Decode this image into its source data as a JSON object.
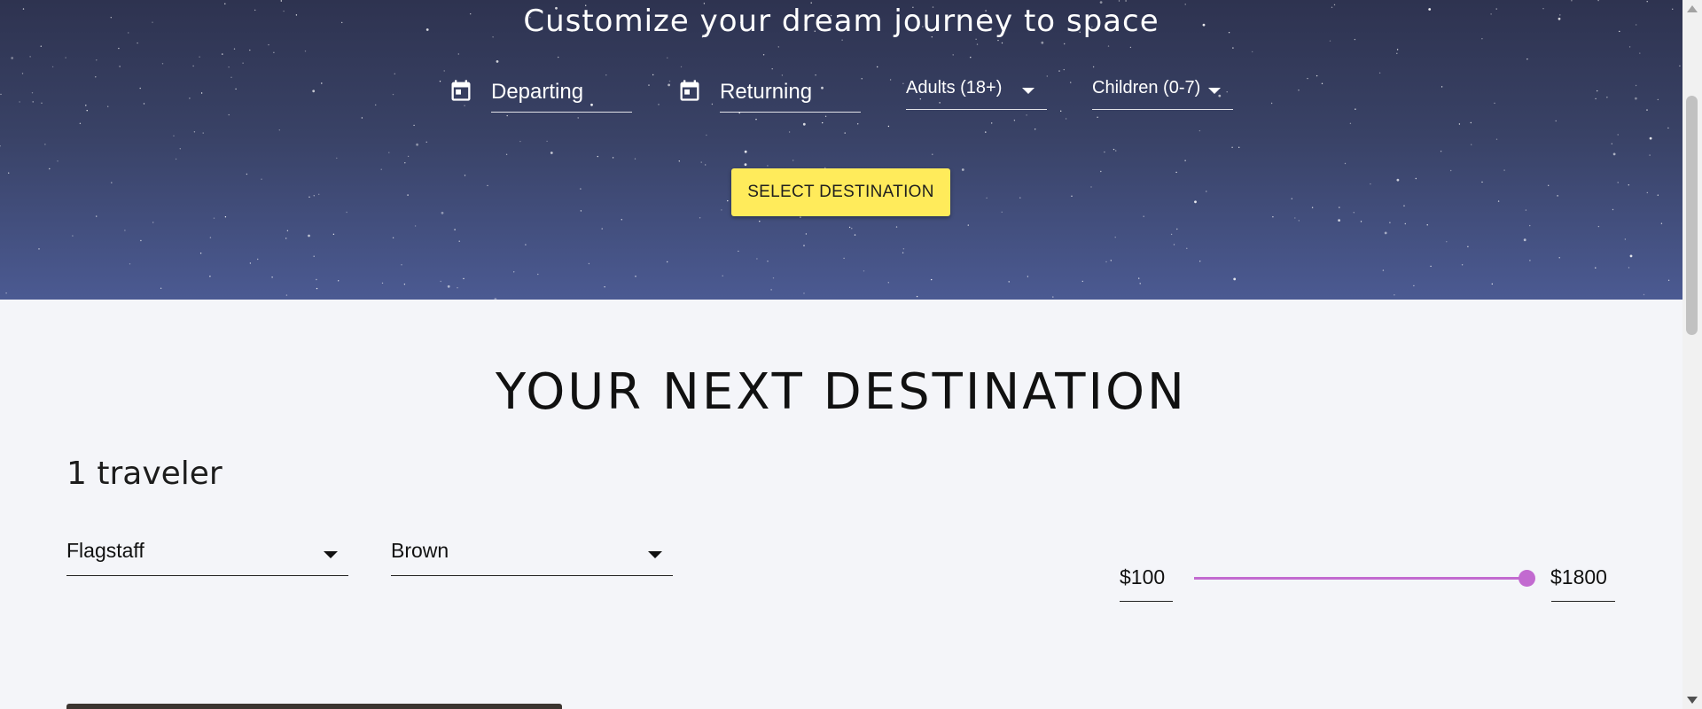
{
  "hero": {
    "title": "Customize your dream journey to space",
    "departing_label": "Departing",
    "returning_label": "Returning",
    "adults_label": "Adults (18+)",
    "children_label": "Children (0-7)",
    "select_button": "SELECT DESTINATION"
  },
  "destination": {
    "heading": "YOUR NEXT DESTINATION",
    "traveler_count": "1 traveler",
    "location_value": "Flagstaff",
    "color_value": "Brown",
    "price_min": "$100",
    "price_max": "$1800",
    "price_slider_level": 1.0
  },
  "colors": {
    "accent_yellow": "#ffeb5b",
    "slider_purple": "#c26ad0",
    "sky_top": "#2e3350",
    "sky_bottom": "#4b5a92"
  },
  "icons": [
    "calendar-icon",
    "chevron-down-icon"
  ]
}
